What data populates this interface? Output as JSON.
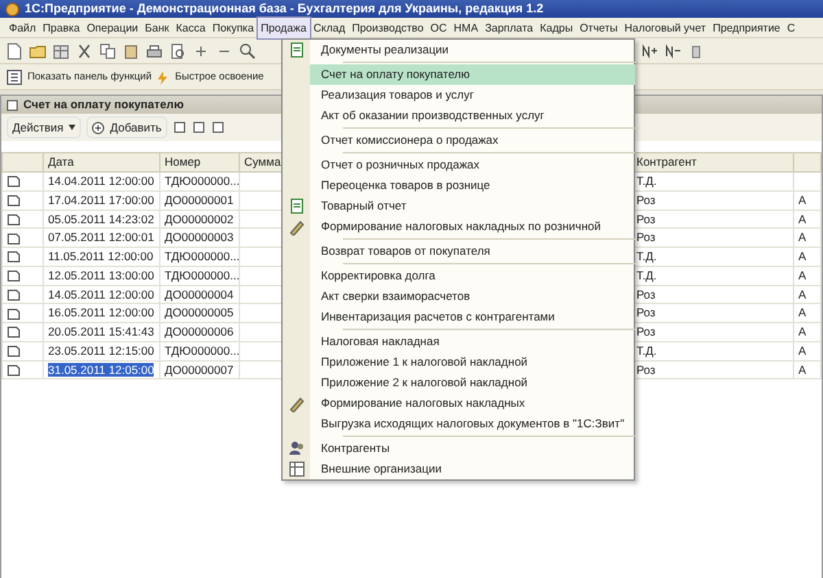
{
  "window": {
    "title": "1С:Предприятие - Демонстрационная база - Бухгалтерия для Украины, редакция 1.2"
  },
  "menu_bar": [
    {
      "label": "Файл",
      "selected": false
    },
    {
      "label": "Правка",
      "selected": false
    },
    {
      "label": "Операции",
      "selected": false
    },
    {
      "label": "Банк",
      "selected": false
    },
    {
      "label": "Касса",
      "selected": false
    },
    {
      "label": "Покупка",
      "selected": false
    },
    {
      "label": "Продажа",
      "selected": true
    },
    {
      "label": "Склад",
      "selected": false
    },
    {
      "label": "Производство",
      "selected": false
    },
    {
      "label": "ОС",
      "selected": false
    },
    {
      "label": "НМА",
      "selected": false
    },
    {
      "label": "Зарплата",
      "selected": false
    },
    {
      "label": "Кадры",
      "selected": false
    },
    {
      "label": "Отчеты",
      "selected": false
    },
    {
      "label": "Налоговый учет",
      "selected": false
    },
    {
      "label": "Предприятие",
      "selected": false
    },
    {
      "label": "С",
      "selected": false
    }
  ],
  "quick_bar": [
    "Показать панель функций",
    "Быстрое освоение"
  ],
  "form": {
    "title": "Счет на оплату покупателю",
    "actions_label": "Действия",
    "add_label": "Добавить",
    "columns": [
      "Дата",
      "Номер",
      "Сумма",
      "Контрагент",
      ""
    ],
    "rows": [
      {
        "date": "14.04.2011 12:00:00",
        "number": "ТДЮ000000...",
        "contractor": "Т.Д.",
        "column_5": "",
        "selected": false
      },
      {
        "date": "17.04.2011 17:00:00",
        "number": "ДО00000001",
        "contractor": "Роз",
        "column_5": "А",
        "selected": false
      },
      {
        "date": "05.05.2011 14:23:02",
        "number": "ДО00000002",
        "contractor": "Роз",
        "column_5": "А",
        "selected": false
      },
      {
        "date": "07.05.2011 12:00:01",
        "number": "ДО00000003",
        "contractor": "Роз",
        "column_5": "А",
        "selected": false
      },
      {
        "date": "11.05.2011 12:00:00",
        "number": "ТДЮ000000...",
        "contractor": "Т.Д.",
        "column_5": "А",
        "selected": false
      },
      {
        "date": "12.05.2011 13:00:00",
        "number": "ТДЮ000000...",
        "contractor": "Т.Д.",
        "column_5": "А",
        "selected": false
      },
      {
        "date": "14.05.2011 12:00:00",
        "number": "ДО00000004",
        "contractor": "Роз",
        "column_5": "А",
        "selected": false
      },
      {
        "date": "16.05.2011 12:00:00",
        "number": "ДО00000005",
        "contractor": "Роз",
        "column_5": "А",
        "selected": false
      },
      {
        "date": "20.05.2011 15:41:43",
        "number": "ДО00000006",
        "contractor": "Роз",
        "column_5": "А",
        "selected": false
      },
      {
        "date": "23.05.2011 12:15:00",
        "number": "ТДЮ000000...",
        "contractor": "Т.Д.",
        "column_5": "А",
        "selected": false
      },
      {
        "date": "31.05.2011 12:05:00",
        "number": "ДО00000007",
        "contractor": "Роз",
        "column_5": "А",
        "selected": true
      }
    ]
  },
  "dropdown": [
    {
      "label": "Документы реализации",
      "kind": "document",
      "separator_before": false,
      "selected": false
    },
    {
      "label": "Счет на оплату покупателю",
      "kind": "plain",
      "separator_before": true,
      "selected": true
    },
    {
      "label": "Реализация товаров и услуг",
      "kind": "plain",
      "separator_before": false,
      "selected": false
    },
    {
      "label": "Акт об оказании производственных услуг",
      "kind": "plain",
      "separator_before": false,
      "selected": false
    },
    {
      "label": "Отчет комиссионера о продажах",
      "kind": "plain",
      "separator_before": true,
      "selected": false
    },
    {
      "label": "Отчет о розничных продажах",
      "kind": "plain",
      "separator_before": true,
      "selected": false
    },
    {
      "label": "Переоценка товаров в рознице",
      "kind": "plain",
      "separator_before": false,
      "selected": false
    },
    {
      "label": "Товарный отчет",
      "kind": "document",
      "separator_before": false,
      "selected": false
    },
    {
      "label": "Формирование налоговых накладных по розничной",
      "kind": "pen",
      "separator_before": false,
      "selected": false
    },
    {
      "label": "Возврат товаров от покупателя",
      "kind": "plain",
      "separator_before": true,
      "selected": false
    },
    {
      "label": "Корректировка долга",
      "kind": "plain",
      "separator_before": true,
      "selected": false
    },
    {
      "label": "Акт сверки взаиморасчетов",
      "kind": "plain",
      "separator_before": false,
      "selected": false
    },
    {
      "label": "Инвентаризация расчетов с контрагентами",
      "kind": "plain",
      "separator_before": false,
      "selected": false
    },
    {
      "label": "Налоговая накладная",
      "kind": "plain",
      "separator_before": true,
      "selected": false
    },
    {
      "label": "Приложение 1 к налоговой накладной",
      "kind": "plain",
      "separator_before": false,
      "selected": false
    },
    {
      "label": "Приложение 2 к налоговой накладной",
      "kind": "plain",
      "separator_before": false,
      "selected": false
    },
    {
      "label": "Формирование налоговых накладных",
      "kind": "pen",
      "separator_before": false,
      "selected": false
    },
    {
      "label": "Выгрузка исходящих налоговых документов в \"1С:Звит\"",
      "kind": "plain",
      "separator_before": false,
      "selected": false
    },
    {
      "label": "Контрагенты",
      "kind": "people",
      "separator_before": true,
      "selected": false
    },
    {
      "label": "Внешние организации",
      "kind": "table",
      "separator_before": false,
      "selected": false
    }
  ]
}
